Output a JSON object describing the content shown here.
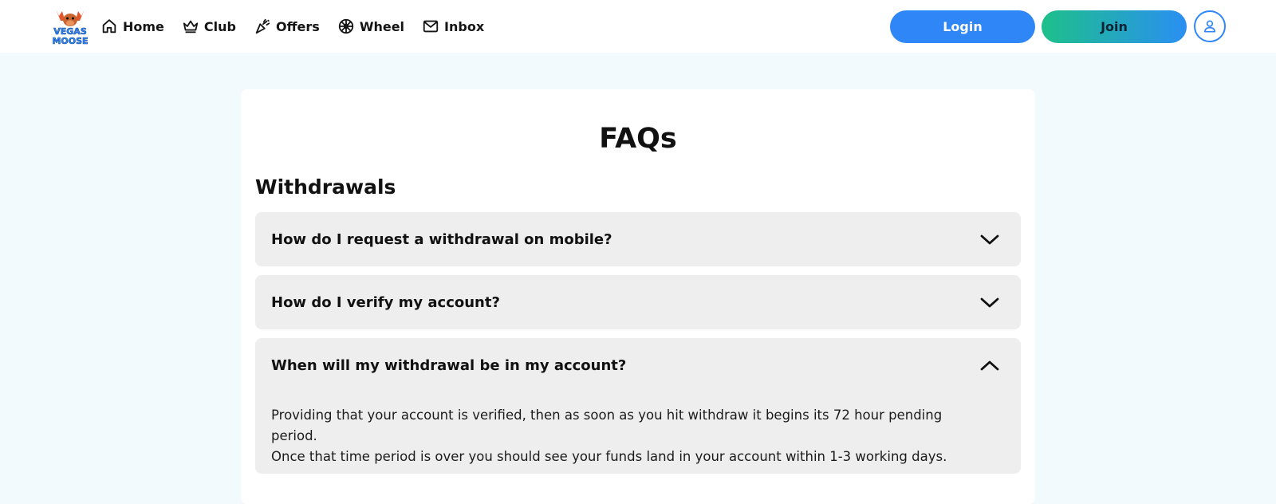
{
  "header": {
    "logo": {
      "line1": "VEGAS",
      "line2": "MOOSE",
      "icon": "moose-logo"
    },
    "nav": [
      {
        "label": "Home",
        "icon": "home-icon"
      },
      {
        "label": "Club",
        "icon": "crown-icon"
      },
      {
        "label": "Offers",
        "icon": "party-popper-icon"
      },
      {
        "label": "Wheel",
        "icon": "wheel-icon"
      },
      {
        "label": "Inbox",
        "icon": "envelope-icon"
      }
    ],
    "login_label": "Login",
    "join_label": "Join",
    "profile_icon": "user-icon"
  },
  "page": {
    "title": "FAQs",
    "section": "Withdrawals",
    "faqs": [
      {
        "question": "How do I request a withdrawal on mobile?",
        "expanded": false
      },
      {
        "question": "How do I verify my account?",
        "expanded": false
      },
      {
        "question": "When will my withdrawal be in my account?",
        "expanded": true,
        "answer_line1": "Providing that your account is verified, then as soon as you hit withdraw it begins its 72 hour pending period.",
        "answer_line2": "Once that time period is over you should see your funds land in your account within 1-3 working days."
      }
    ]
  },
  "colors": {
    "background": "#f3fafd",
    "login_button": "#2f86f6",
    "join_gradient_start": "#1dc08a",
    "join_gradient_end": "#2a8ff2",
    "faq_panel": "#eeeeee"
  }
}
